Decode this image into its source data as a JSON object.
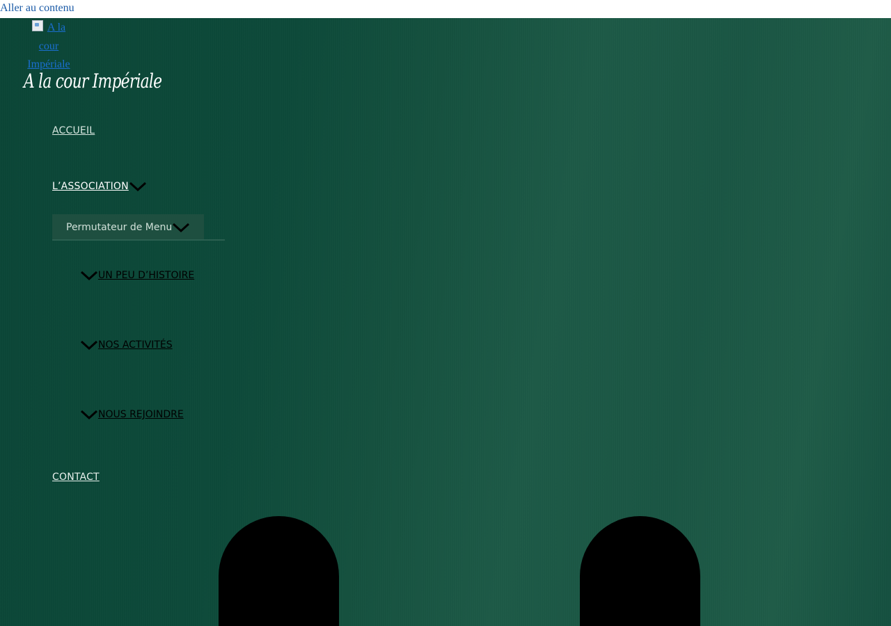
{
  "skip_link": "Aller au contenu",
  "logo": {
    "alt_text": "A la cour Impériale",
    "script_text": "A la cour Impériale"
  },
  "nav": {
    "items": [
      {
        "label": "ACCUEIL"
      },
      {
        "label": "L’ASSOCIATION",
        "has_submenu": true
      },
      {
        "label": "CONTACT"
      }
    ],
    "menu_toggle_label": "Permutateur de Menu",
    "submenu": [
      {
        "label": "UN PEU D’HISTOIRE"
      },
      {
        "label": "NOS ACTIVITÉS"
      },
      {
        "label": "NOUS REJOINDRE"
      }
    ]
  },
  "colors": {
    "background_primary": "#0b4637",
    "background_secondary": "#1d5a47",
    "toggle_bg": "#1e4f40",
    "link": "#1a5aa6"
  },
  "icons": {
    "chevron": "chevron-down-icon",
    "broken_image": "broken-image-icon"
  }
}
